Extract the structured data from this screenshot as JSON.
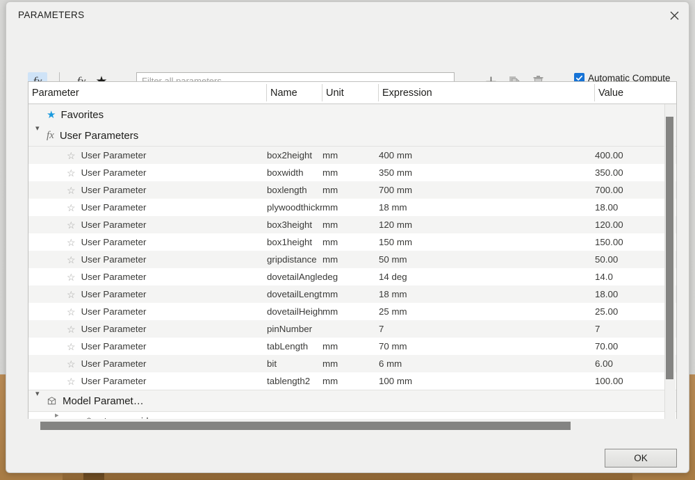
{
  "dialog": {
    "title": "PARAMETERS",
    "close_icon": "close-icon",
    "ok_label": "OK"
  },
  "toolbar": {
    "fx_label": "fx",
    "fx_user_label": "fx",
    "favorite_icon": "star-icon",
    "add_icon": "plus-icon",
    "duplicate_icon": "copy-icon",
    "delete_icon": "trash-icon",
    "filter": {
      "placeholder": "Filter all parameters",
      "value": ""
    },
    "automatic_compute": {
      "label": "Automatic Compute",
      "checked": true,
      "accent": "#1673d6"
    }
  },
  "table": {
    "sort_indicator": "⌄",
    "columns": [
      {
        "key": "parameter",
        "label": "Parameter"
      },
      {
        "key": "name",
        "label": "Name"
      },
      {
        "key": "unit",
        "label": "Unit"
      },
      {
        "key": "expression",
        "label": "Expression"
      },
      {
        "key": "value",
        "label": "Value"
      }
    ],
    "groups": [
      {
        "id": "favorites",
        "label": "Favorites",
        "icon": "star-icon",
        "expanded": false,
        "has_chevron": false
      },
      {
        "id": "user-parameters",
        "label": "User Parameters",
        "icon": "fx-icon",
        "expanded": true,
        "has_chevron": true,
        "chevron": "⌄"
      },
      {
        "id": "model-parameters",
        "label": "Model Paramet…",
        "icon": "cube-icon",
        "expanded": true,
        "has_chevron": true,
        "chevron": "⌄"
      }
    ],
    "rows": [
      {
        "parameter": "User Parameter",
        "name": "box2height",
        "unit": "mm",
        "expression": "400 mm",
        "value": "400.00"
      },
      {
        "parameter": "User Parameter",
        "name": "boxwidth",
        "unit": "mm",
        "expression": "350 mm",
        "value": "350.00"
      },
      {
        "parameter": "User Parameter",
        "name": "boxlength",
        "unit": "mm",
        "expression": "700 mm",
        "value": "700.00"
      },
      {
        "parameter": "User Parameter",
        "name": "plywoodthickness",
        "unit": "mm",
        "expression": "18 mm",
        "value": "18.00"
      },
      {
        "parameter": "User Parameter",
        "name": "box3height",
        "unit": "mm",
        "expression": "120 mm",
        "value": "120.00"
      },
      {
        "parameter": "User Parameter",
        "name": "box1height",
        "unit": "mm",
        "expression": "150 mm",
        "value": "150.00"
      },
      {
        "parameter": "User Parameter",
        "name": "gripdistance",
        "unit": "mm",
        "expression": "50 mm",
        "value": "50.00"
      },
      {
        "parameter": "User Parameter",
        "name": "dovetailAngle",
        "unit": "deg",
        "expression": "14 deg",
        "value": "14.0"
      },
      {
        "parameter": "User Parameter",
        "name": "dovetailLength",
        "unit": "mm",
        "expression": "18 mm",
        "value": "18.00"
      },
      {
        "parameter": "User Parameter",
        "name": "dovetailHeight",
        "unit": "mm",
        "expression": "25 mm",
        "value": "25.00"
      },
      {
        "parameter": "User Parameter",
        "name": "pinNumber",
        "unit": "",
        "expression": "7",
        "value": "7"
      },
      {
        "parameter": "User Parameter",
        "name": "tabLength",
        "unit": "mm",
        "expression": "70 mm",
        "value": "70.00"
      },
      {
        "parameter": "User Parameter",
        "name": "bit",
        "unit": "mm",
        "expression": "6 mm",
        "value": "6.00"
      },
      {
        "parameter": "User Parameter",
        "name": "tablength2",
        "unit": "mm",
        "expression": "100 mm",
        "value": "100.00"
      }
    ],
    "model_children": [
      {
        "label": "storage mid",
        "icon": "cube-icon",
        "expanded": false,
        "chevron": "›"
      }
    ]
  }
}
